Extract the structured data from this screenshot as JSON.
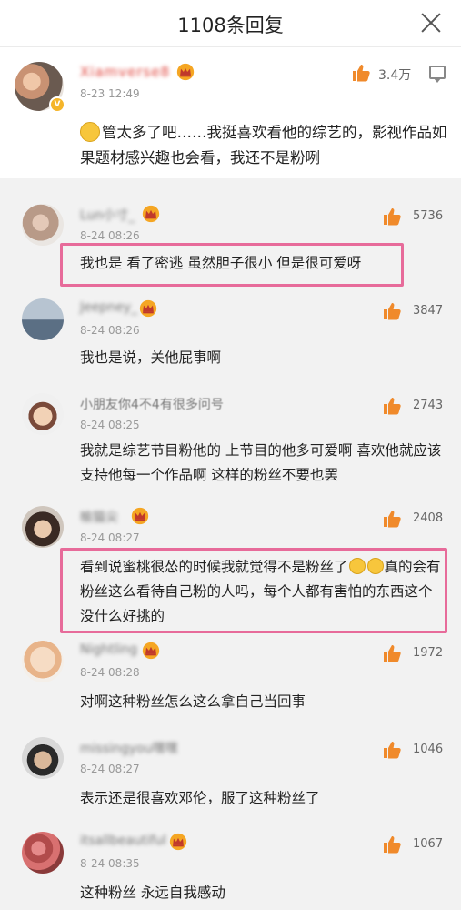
{
  "header": {
    "title": "1108条回复"
  },
  "main_comment": {
    "username": "Xiamverse8",
    "time": "8-23 12:49",
    "likes": "3.4万",
    "text": "管太多了吧……我挺喜欢看他的综艺的，影视作品如果题材感兴趣也会看，我还不是粉咧"
  },
  "replies": [
    {
      "username": "Lun小寸_",
      "time": "8-24 08:26",
      "likes": "5736",
      "text": "我也是 看了密逃 虽然胆子很小 但是很可爱呀"
    },
    {
      "username": "Jeepney_",
      "time": "8-24 08:26",
      "likes": "3847",
      "text": "我也是说，关他屁事啊"
    },
    {
      "username": "小朋友你4不4有很多问号",
      "time": "8-24 08:25",
      "likes": "2743",
      "text": "我就是综艺节目粉他的 上节目的他多可爱啊 喜欢他就应该支持他每一个作品啊 这样的粉丝不要也罢"
    },
    {
      "username": "榆猫尖",
      "time": "8-24 08:27",
      "likes": "2408",
      "text_parts": [
        "看到说蜜桃很怂的时候我就觉得不是粉丝了",
        "真的会有粉丝这么看待自己粉的人吗，每个人都有害怕的东西这个没什么好挑的"
      ]
    },
    {
      "username": "Nightling",
      "time": "8-24 08:28",
      "likes": "1972",
      "text": "对啊这种粉丝怎么这么拿自己当回事"
    },
    {
      "username": "missingyou嘿嘿",
      "time": "8-24 08:27",
      "likes": "1046",
      "text": "表示还是很喜欢邓伦，服了这种粉丝了"
    },
    {
      "username": "itsallbeautiful",
      "time": "8-24 08:35",
      "likes": "1067",
      "text": "这种粉丝 永远自我感动"
    }
  ],
  "colors": {
    "highlight_border": "#e76b9a",
    "like_icon": "#f08a2b",
    "crown": "#f5a623",
    "vip_name": "#e0433b",
    "reply_bg": "#f2f2f2"
  }
}
